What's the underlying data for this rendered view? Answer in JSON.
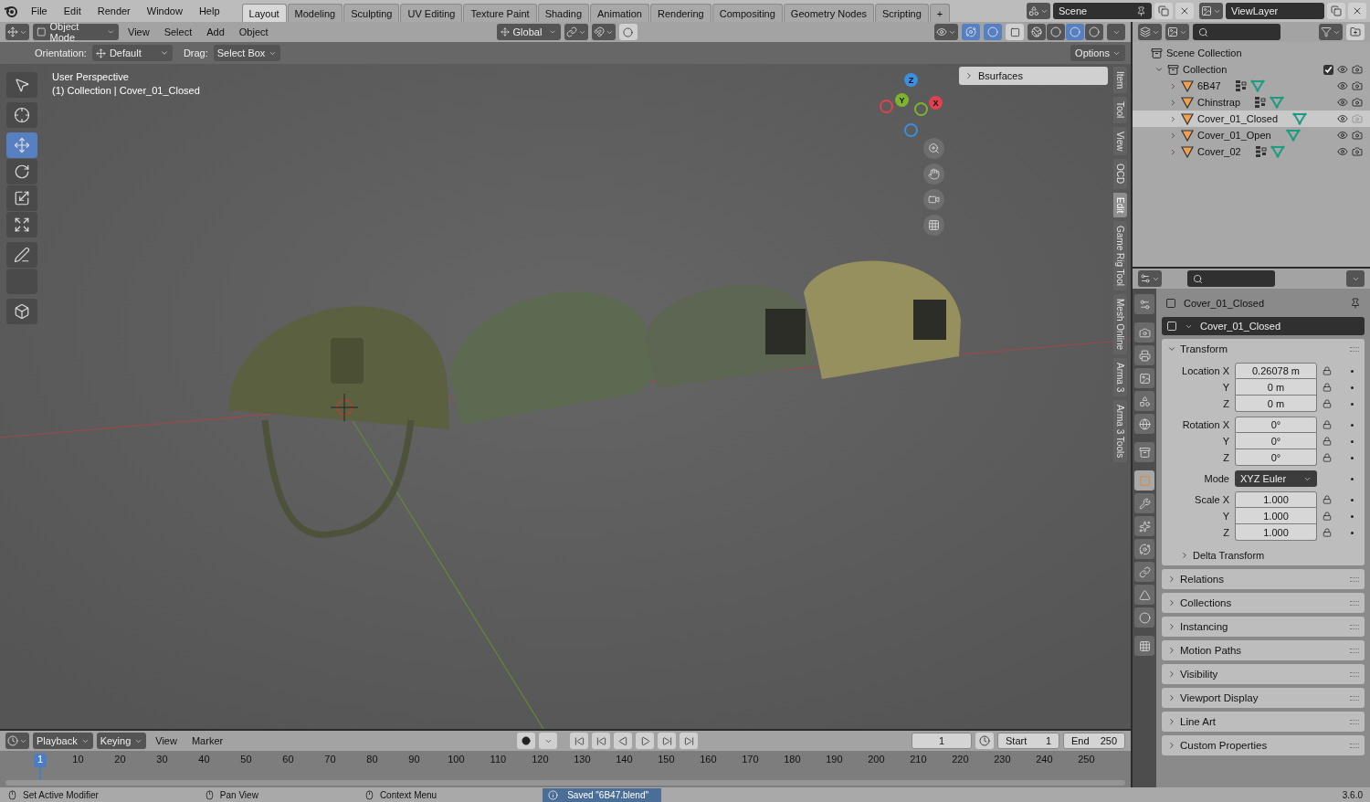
{
  "menu": [
    "File",
    "Edit",
    "Render",
    "Window",
    "Help"
  ],
  "workspaces": [
    {
      "label": "Layout",
      "selected": true
    },
    {
      "label": "Modeling",
      "selected": false
    },
    {
      "label": "Sculpting",
      "selected": false
    },
    {
      "label": "UV Editing",
      "selected": false
    },
    {
      "label": "Texture Paint",
      "selected": false
    },
    {
      "label": "Shading",
      "selected": false
    },
    {
      "label": "Animation",
      "selected": false
    },
    {
      "label": "Rendering",
      "selected": false
    },
    {
      "label": "Compositing",
      "selected": false
    },
    {
      "label": "Geometry Nodes",
      "selected": false
    },
    {
      "label": "Scripting",
      "selected": false
    }
  ],
  "add_workspace": "+",
  "scene": "Scene",
  "view_layer": "ViewLayer",
  "viewport_header": {
    "mode": "Object Mode",
    "menus": [
      "View",
      "Select",
      "Add",
      "Object"
    ],
    "orientation": "Global",
    "gizmos_on": true,
    "overlays_on": true,
    "xray_on": false,
    "shading": [
      {
        "kind": "wireframe",
        "selected": false
      },
      {
        "kind": "solid",
        "selected": false
      },
      {
        "kind": "material",
        "selected": true
      },
      {
        "kind": "rendered",
        "selected": false
      }
    ]
  },
  "tool_settings": {
    "orientation_label": "Orientation:",
    "orientation": "Default",
    "drag_label": "Drag:",
    "drag": "Select Box",
    "options": "Options"
  },
  "viewport": {
    "overlay_lines": [
      "User Perspective",
      "(1) Collection | Cover_01_Closed"
    ],
    "gizmo_axes": [
      "Z",
      "Y",
      "X"
    ],
    "panel": "Bsurfaces"
  },
  "toolbar": [
    {
      "kind": "select",
      "selected": false
    },
    {
      "kind": "cursor",
      "selected": false
    },
    {
      "kind": "move",
      "selected": true
    },
    {
      "kind": "rotate",
      "selected": false
    },
    {
      "kind": "scale",
      "selected": false
    },
    {
      "kind": "transform",
      "selected": false
    },
    {
      "kind": "annotate",
      "selected": false
    },
    {
      "kind": "measure",
      "selected": false
    },
    {
      "kind": "add-cube",
      "selected": false
    }
  ],
  "sidebar_tabs": [
    {
      "label": "Item",
      "selected": false
    },
    {
      "label": "Tool",
      "selected": false
    },
    {
      "label": "View",
      "selected": false
    },
    {
      "label": "OCD",
      "selected": false
    },
    {
      "label": "Edit",
      "selected": true
    },
    {
      "label": "Game Rig Tool",
      "selected": false
    },
    {
      "label": "Mesh Online",
      "selected": false
    },
    {
      "label": "Arma 3",
      "selected": false
    },
    {
      "label": "Arma 3 Tools",
      "selected": false
    }
  ],
  "outliner": {
    "root": "Scene Collection",
    "collection": {
      "name": "Collection",
      "expanded": true,
      "checked": true,
      "children": [
        {
          "name": "6B47",
          "selected": false,
          "has_modifiers": true,
          "render_enabled": true
        },
        {
          "name": "Chinstrap",
          "selected": false,
          "has_modifiers": true,
          "render_enabled": true
        },
        {
          "name": "Cover_01_Closed",
          "selected": true,
          "has_modifiers": false,
          "render_enabled": false
        },
        {
          "name": "Cover_01_Open",
          "selected": false,
          "has_modifiers": false,
          "render_enabled": true
        },
        {
          "name": "Cover_02",
          "selected": false,
          "has_modifiers": true,
          "render_enabled": true
        }
      ]
    }
  },
  "properties": {
    "tabs": [
      {
        "kind": "tool",
        "selected": false
      },
      {
        "kind": "render",
        "selected": false
      },
      {
        "kind": "output",
        "selected": false
      },
      {
        "kind": "view-layer",
        "selected": false
      },
      {
        "kind": "scene",
        "selected": false
      },
      {
        "kind": "world",
        "selected": false
      },
      {
        "kind": "collection",
        "selected": false
      },
      {
        "kind": "object",
        "selected": true
      },
      {
        "kind": "modifier",
        "selected": false
      },
      {
        "kind": "particles",
        "selected": false
      },
      {
        "kind": "physics",
        "selected": false
      },
      {
        "kind": "constraints",
        "selected": false
      },
      {
        "kind": "data",
        "selected": false
      },
      {
        "kind": "material",
        "selected": false
      },
      {
        "kind": "texture",
        "selected": false
      }
    ],
    "context": "Cover_01_Closed",
    "object_name": "Cover_01_Closed",
    "transform": {
      "title": "Transform",
      "expanded": true,
      "groups": [
        {
          "rows": [
            {
              "label": "Location X",
              "value": "0.26078 m",
              "kind": "number"
            },
            {
              "label": "Y",
              "value": "0 m",
              "kind": "number"
            },
            {
              "label": "Z",
              "value": "0 m",
              "kind": "number"
            }
          ]
        },
        {
          "rows": [
            {
              "label": "Rotation X",
              "value": "0°",
              "kind": "number"
            },
            {
              "label": "Y",
              "value": "0°",
              "kind": "number"
            },
            {
              "label": "Z",
              "value": "0°",
              "kind": "number"
            }
          ]
        },
        {
          "rows": [
            {
              "label": "Mode",
              "value": "XYZ Euler",
              "kind": "dropdown"
            }
          ]
        },
        {
          "rows": [
            {
              "label": "Scale X",
              "value": "1.000",
              "kind": "number"
            },
            {
              "label": "Y",
              "value": "1.000",
              "kind": "number"
            },
            {
              "label": "Z",
              "value": "1.000",
              "kind": "number"
            }
          ]
        }
      ],
      "subpanel": "Delta Transform"
    },
    "panels": [
      "Relations",
      "Collections",
      "Instancing",
      "Motion Paths",
      "Visibility",
      "Viewport Display",
      "Line Art",
      "Custom Properties"
    ]
  },
  "timeline": {
    "menus": [
      {
        "label": "Playback",
        "dropdown": true
      },
      {
        "label": "Keying",
        "dropdown": true
      },
      {
        "label": "View",
        "dropdown": false
      },
      {
        "label": "Marker",
        "dropdown": false
      }
    ],
    "current_frame": "1",
    "start_label": "Start",
    "start": "1",
    "end_label": "End",
    "end": "250",
    "playhead": "1",
    "ticks": [
      "10",
      "20",
      "30",
      "40",
      "50",
      "60",
      "70",
      "80",
      "90",
      "100",
      "110",
      "120",
      "130",
      "140",
      "150",
      "160",
      "170",
      "180",
      "190",
      "200",
      "210",
      "220",
      "230",
      "240",
      "250"
    ]
  },
  "status_bar": {
    "hints": [
      "Set Active Modifier",
      "Pan View",
      "Context Menu"
    ],
    "message": "Saved \"6B47.blend\"",
    "version": "3.6.0"
  }
}
